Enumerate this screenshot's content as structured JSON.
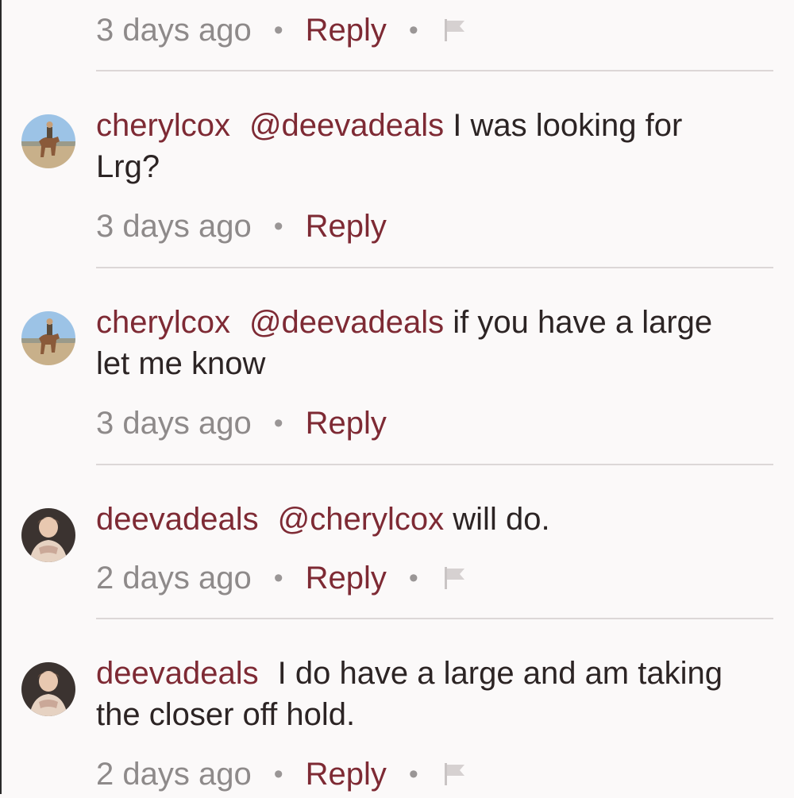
{
  "colors": {
    "accent": "#7e2a34",
    "text": "#2c2424",
    "muted": "#8e8a8a",
    "background": "#fbf9f9",
    "divider": "#dcd7d7"
  },
  "top_meta": {
    "time": "3 days ago",
    "reply": "Reply",
    "flag_icon": "flag-icon"
  },
  "comments": [
    {
      "username": "cherylcox",
      "avatar_icon": "horse-rider-avatar",
      "mention": "@deevadeals",
      "text": " I was looking for Lrg?",
      "time": "3 days ago",
      "reply": "Reply"
    },
    {
      "username": "cherylcox",
      "avatar_icon": "horse-rider-avatar",
      "mention": "@deevadeals",
      "text": " if you have a large let me know",
      "time": "3 days ago",
      "reply": "Reply"
    },
    {
      "username": "deevadeals",
      "avatar_icon": "woman-portrait-avatar",
      "mention": "@cherylcox",
      "text": " will do.",
      "time": "2 days ago",
      "reply": "Reply",
      "flag_icon": "flag-icon"
    },
    {
      "username": "deevadeals",
      "avatar_icon": "woman-portrait-avatar",
      "mention": "",
      "text": "I do have a large and am taking the closer off hold.",
      "time": "2 days ago",
      "reply": "Reply",
      "flag_icon": "flag-icon"
    }
  ]
}
